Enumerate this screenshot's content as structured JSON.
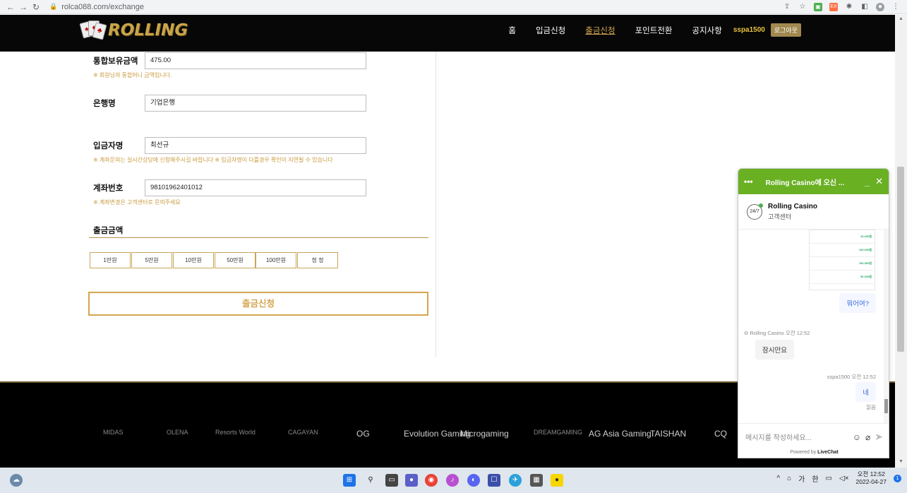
{
  "browser": {
    "url": "rolca088.com/exchange"
  },
  "header": {
    "logo_text": "ROLLING",
    "nav": [
      "홈",
      "입금신청",
      "출금신청",
      "포인트전환",
      "공지사항"
    ],
    "active_nav": "출금신청",
    "username": "sspa1500",
    "logout_label": "로그아웃"
  },
  "form": {
    "balance_label": "통합보유금액",
    "balance_value": "475.00",
    "balance_note": "※ 회원님의 통합머니 금액입니다.",
    "bank_label": "은행명",
    "bank_value": "기업은행",
    "depositor_label": "입금자명",
    "depositor_value": "최선규",
    "depositor_note": "※ 계좌문의는 실시간상담에 신청해주시길 바랍니다 ※ 입금자명이 다를경우 확인이 지연될 수 있습니다",
    "account_label": "계좌번호",
    "account_value": "98101962401012",
    "account_note": "※ 계좌변경은 고객센터로 문의주세요",
    "amount_title": "출금금액",
    "amount_buttons": [
      "1만원",
      "5만원",
      "10만원",
      "50만원",
      "100만원",
      "정 정"
    ],
    "submit_label": "출금신청"
  },
  "footer": {
    "providers": [
      "MIDAS",
      "OLENA",
      "Resorts World",
      "CAGAYAN",
      "OG",
      "Evolution Gaming",
      "Microgaming",
      "DREAMGAMING",
      "AG Asia Gaming",
      "TAISHAN",
      "CQ"
    ]
  },
  "chat": {
    "header_title": "Rolling Casino에 오신 ...",
    "agent_name": "Rolling Casino",
    "agent_sub": "고객센터",
    "agent_avatar": "24/7",
    "msg_user_1": "뭐어여?",
    "agent_meta": "Rolling Casino 오전 12:52",
    "msg_agent": "잠시만요",
    "user_meta": "sspa1500 오전 12:52",
    "msg_user_2": "네",
    "read_label": "읽음",
    "placeholder": "메시지를 작성하세요...",
    "powered_prefix": "Powered by",
    "powered_brand": "LiveChat",
    "shot_values": [
      "10,000원",
      "100,000원",
      "100,000원",
      "50,000원"
    ]
  },
  "taskbar": {
    "ime_1": "가",
    "ime_2": "한",
    "time": "오전 12:52",
    "date": "2022-04-27",
    "notif_count": "1"
  },
  "colors": {
    "accent_gold": "#d4a650",
    "chat_green": "#6ab023",
    "header_bg": "#070707"
  }
}
